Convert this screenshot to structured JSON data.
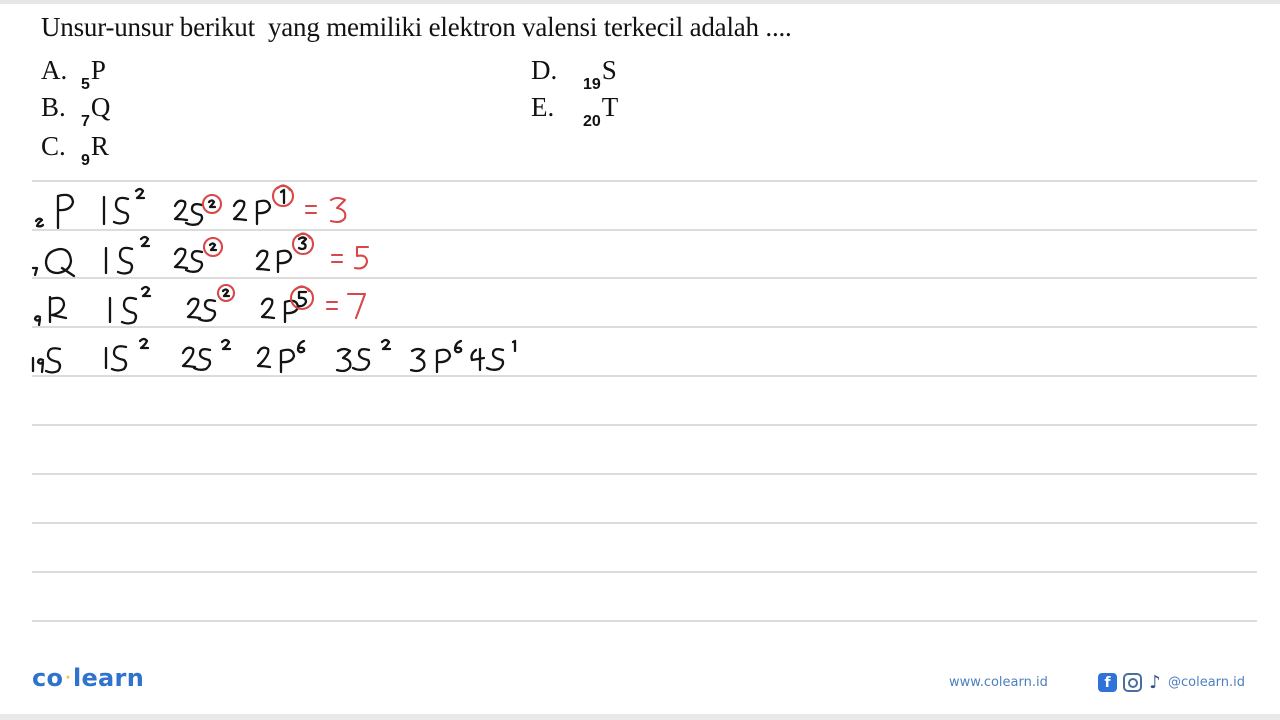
{
  "question": {
    "text": "Unsur-unsur berikut  yang memiliki elektron valensi terkecil adalah ...."
  },
  "options": [
    {
      "letter": "A.",
      "atomic_number": "5",
      "symbol": "P"
    },
    {
      "letter": "B.",
      "atomic_number": "7",
      "symbol": "Q"
    },
    {
      "letter": "C.",
      "atomic_number": "9",
      "symbol": "R"
    },
    {
      "letter": "D.",
      "atomic_number": "19",
      "symbol": "S"
    },
    {
      "letter": "E.",
      "atomic_number": "20",
      "symbol": "T"
    }
  ],
  "handwritten_solution": [
    {
      "element": "5P",
      "configuration": "1s2 2s2 2p1",
      "circled": [
        "2",
        "1"
      ],
      "valence_result": "= 3"
    },
    {
      "element": "7Q",
      "configuration": "1s2 2s2 2p3",
      "circled": [
        "2",
        "3"
      ],
      "valence_result": "= 5"
    },
    {
      "element": "9R",
      "configuration": "1s2 2s2 2p5",
      "circled": [
        "2",
        "5"
      ],
      "valence_result": "= 7"
    },
    {
      "element": "19S",
      "configuration": "1s2 2s2 2p6 3s2 3p6 4s1",
      "circled": [],
      "valence_result": ""
    }
  ],
  "colors": {
    "ink": "#141414",
    "annotation_red": "#d8474a",
    "brand_blue": "#2f73cc",
    "brand_dot": "#f2c230"
  },
  "footer": {
    "logo_left": "co",
    "logo_dot": "·",
    "logo_right": "learn",
    "website": "www.colearn.id",
    "social_icons": [
      "facebook-icon",
      "instagram-icon",
      "tiktok-icon"
    ],
    "facebook_glyph": "f",
    "tiktok_glyph": "♪",
    "handle": "@colearn.id"
  }
}
